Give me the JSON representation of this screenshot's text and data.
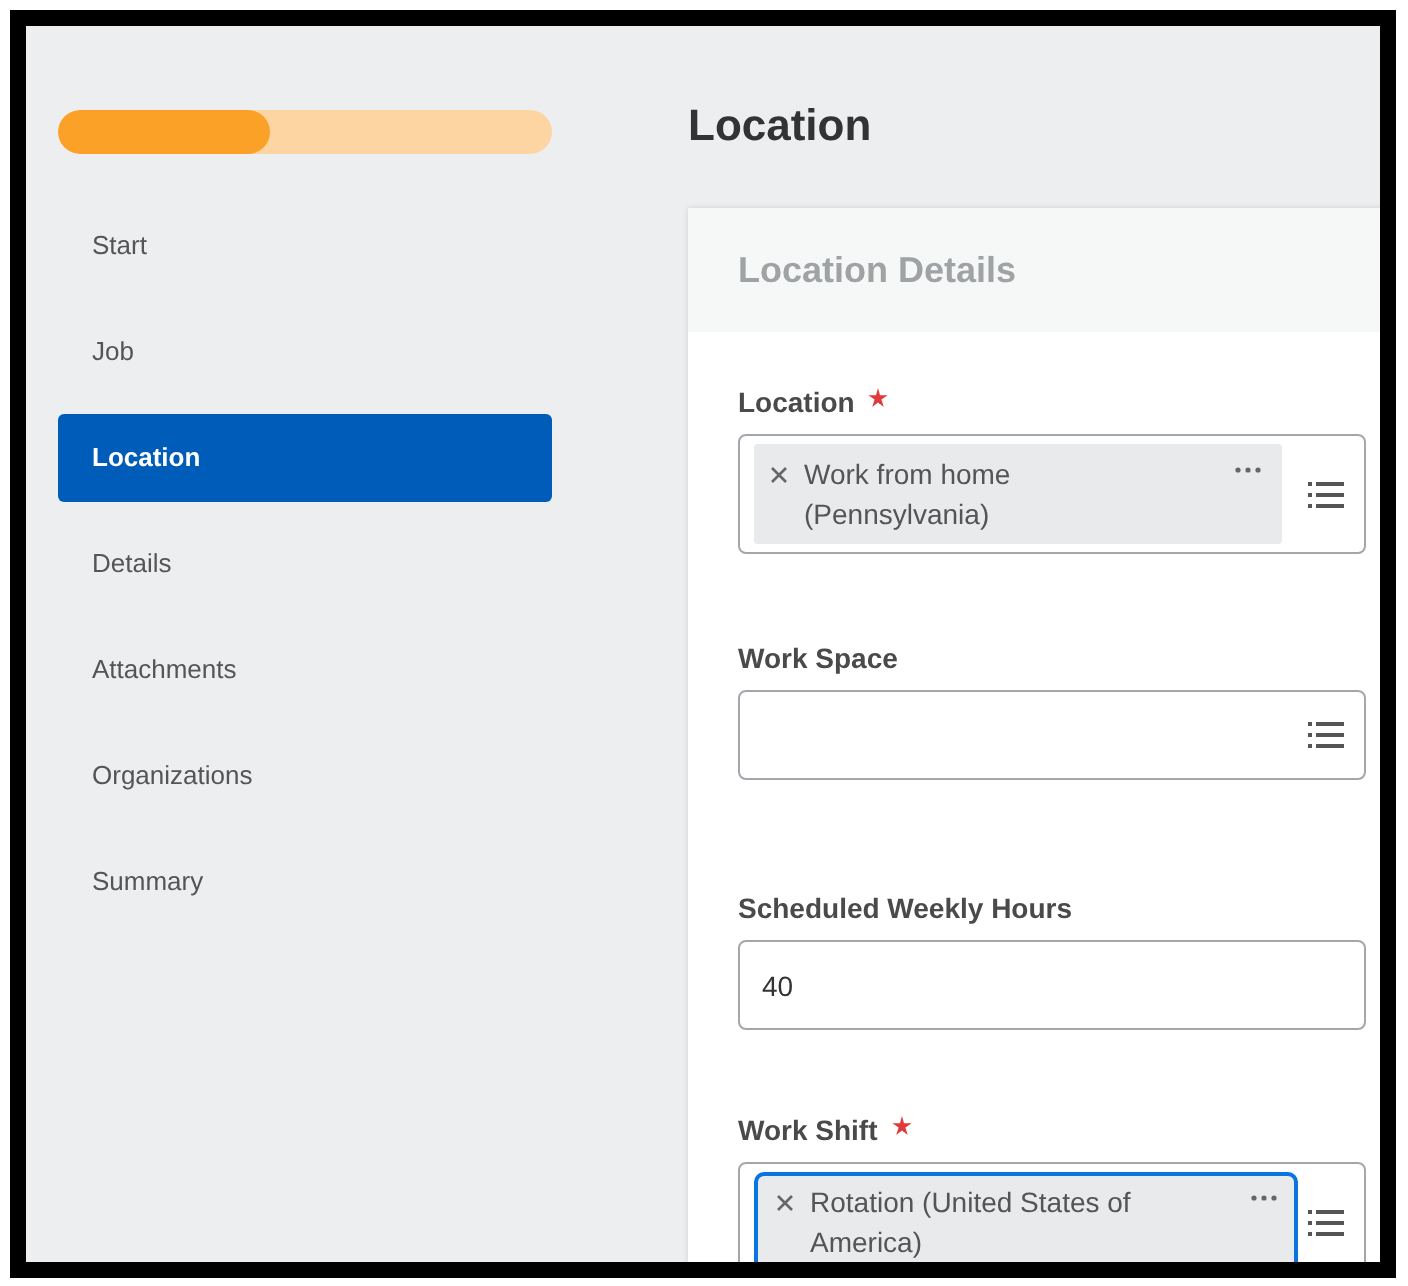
{
  "progress": {
    "level": 0.43
  },
  "steps": [
    {
      "label": "Start",
      "selected": false
    },
    {
      "label": "Job",
      "selected": false
    },
    {
      "label": "Location",
      "selected": true
    },
    {
      "label": "Details",
      "selected": false
    },
    {
      "label": "Attachments",
      "selected": false
    },
    {
      "label": "Organizations",
      "selected": false
    },
    {
      "label": "Summary",
      "selected": false
    }
  ],
  "page_title": "Location",
  "section": {
    "title": "Location Details",
    "fields": [
      {
        "label": "Location",
        "required": true,
        "kind": "prompt",
        "chips": [
          {
            "text": "Work from home (Pennsylvania)",
            "focused": false
          }
        ]
      },
      {
        "label": "Work Space",
        "required": false,
        "kind": "prompt"
      },
      {
        "label": "Scheduled Weekly Hours",
        "required": false,
        "kind": "text",
        "value": "40"
      },
      {
        "label": "Work Shift",
        "required": true,
        "kind": "prompt",
        "chips": [
          {
            "text": "Rotation (United States of America)",
            "focused": true
          }
        ]
      }
    ]
  }
}
